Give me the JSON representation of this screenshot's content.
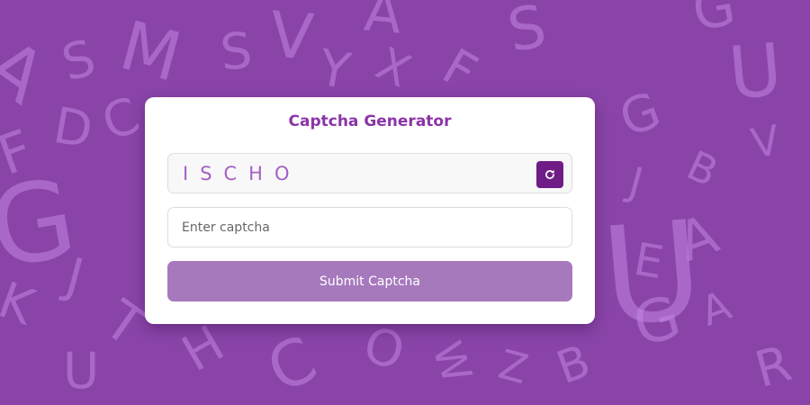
{
  "page": {
    "background_color": "#8a44a8",
    "background_letters": [
      "A",
      "S",
      "M",
      "S",
      "V",
      "Y",
      "A",
      "X",
      "F",
      "S",
      "G",
      "F",
      "D",
      "C",
      "G",
      "V",
      "B",
      "J",
      "U",
      "G",
      "A",
      "E",
      "G",
      "U",
      "J",
      "T",
      "K",
      "H",
      "C",
      "O",
      "W",
      "Z",
      "B",
      "U",
      "R",
      "A"
    ]
  },
  "card": {
    "title": "Captcha Generator",
    "captcha": {
      "text": "ISCHO",
      "refresh_icon": "refresh-icon",
      "text_color": "#a461c4",
      "button_color": "#6f1c86"
    },
    "input": {
      "placeholder": "Enter captcha",
      "value": ""
    },
    "submit": {
      "label": "Submit Captcha",
      "color": "#a679bd"
    },
    "title_color": "#8b34a7"
  }
}
